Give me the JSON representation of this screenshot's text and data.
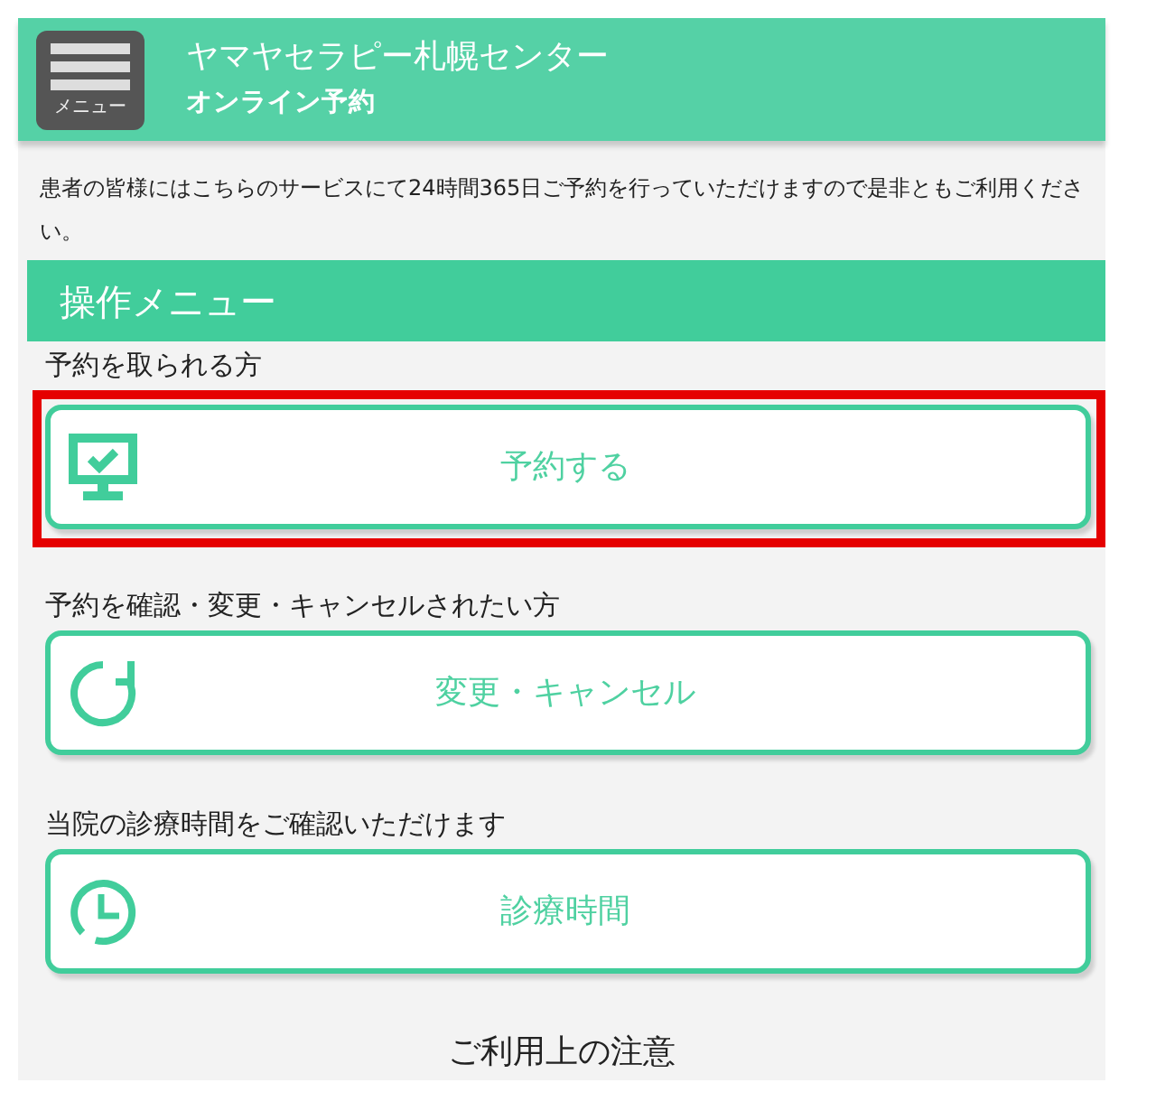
{
  "header": {
    "menu_button": {
      "label": "メニュー"
    },
    "title": "ヤマヤセラピー札幌センター",
    "subtitle": "オンライン予約"
  },
  "intro": "患者の皆様にはこちらのサービスにて24時間365日ご予約を行っていただけますので是非ともご利用ください。",
  "section_title": "操作メニュー",
  "actions": [
    {
      "kind": "reserve",
      "caption": "予約を取られる方",
      "label": "予約する",
      "highlighted": true
    },
    {
      "kind": "change",
      "caption": "予約を確認・変更・キャンセルされたい方",
      "label": "変更・キャンセル",
      "highlighted": false
    },
    {
      "kind": "hours",
      "caption": "当院の診療時間をご確認いただけます",
      "label": "診療時間",
      "highlighted": false
    }
  ],
  "footer_heading": "ご利用上の注意"
}
